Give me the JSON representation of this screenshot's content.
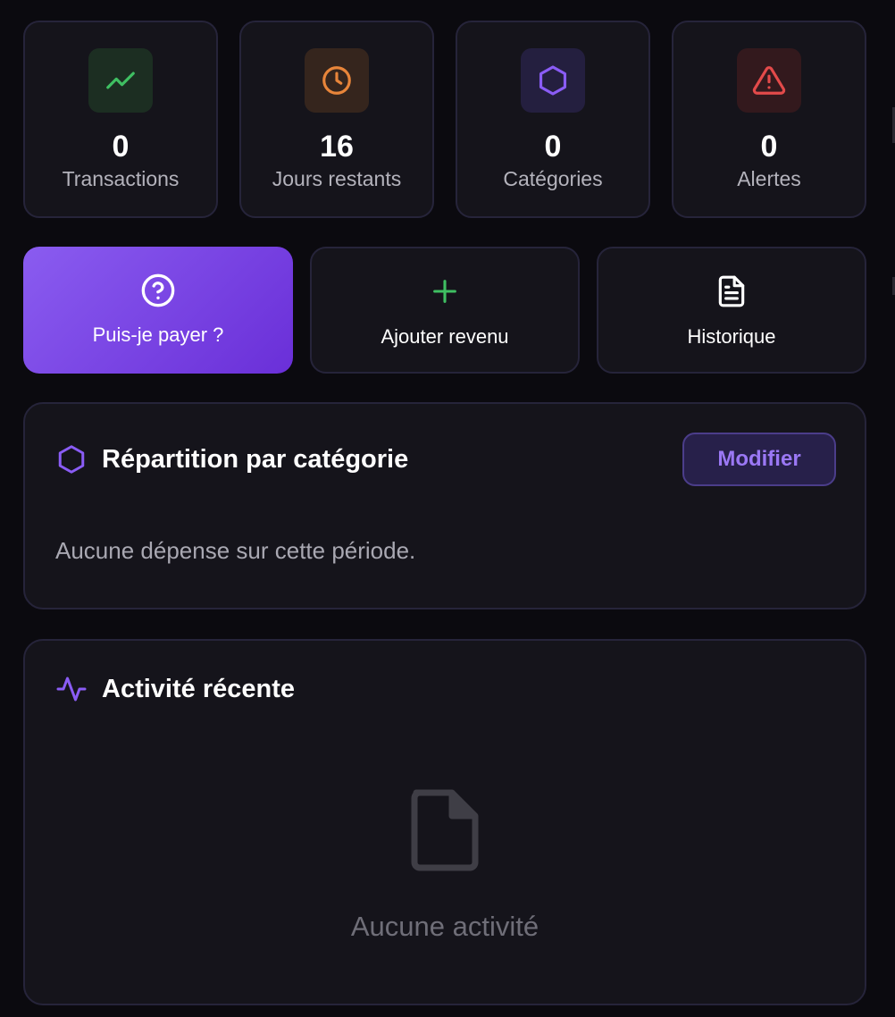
{
  "stats": [
    {
      "value": "0",
      "label": "Transactions",
      "icon": "trending-up-icon",
      "color": "#3fbf62",
      "bg": "#1c2e22"
    },
    {
      "value": "16",
      "label": "Jours restants",
      "icon": "clock-icon",
      "color": "#e8853a",
      "bg": "#35251d"
    },
    {
      "value": "0",
      "label": "Catégories",
      "icon": "hexagon-icon",
      "color": "#8a5cf5",
      "bg": "#241f3f"
    },
    {
      "value": "0",
      "label": "Alertes",
      "icon": "alert-triangle-icon",
      "color": "#e34a4a",
      "bg": "#33191d"
    }
  ],
  "actions": [
    {
      "label": "Puis-je payer ?",
      "icon": "help-circle-icon"
    },
    {
      "label": "Ajouter revenu",
      "icon": "plus-icon"
    },
    {
      "label": "Historique",
      "icon": "file-text-icon"
    }
  ],
  "repartition": {
    "title": "Répartition par catégorie",
    "modify_label": "Modifier",
    "empty_text": "Aucune dépense sur cette période.",
    "icon": "hexagon-icon"
  },
  "activity": {
    "title": "Activité récente",
    "empty_label": "Aucune activité",
    "icon": "activity-icon",
    "empty_icon": "file-icon"
  },
  "colors": {
    "accent": "#8a5cf5",
    "background": "#0b0a0f",
    "card": "#15141b",
    "border": "#26243a"
  }
}
